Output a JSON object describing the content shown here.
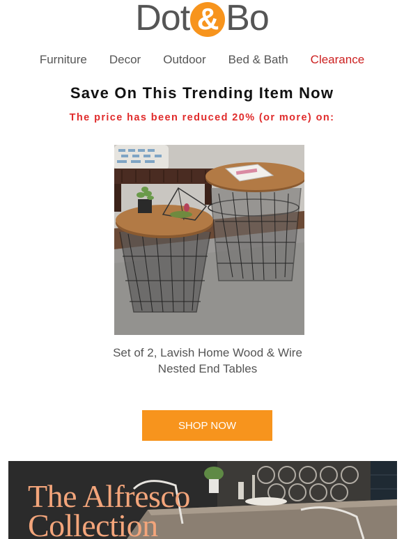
{
  "header": {
    "logo_left": "Dot",
    "logo_amp": "&",
    "logo_right": "Bo"
  },
  "nav": {
    "items": [
      "Furniture",
      "Decor",
      "Outdoor",
      "Bed & Bath"
    ],
    "clearance": "Clearance"
  },
  "promo": {
    "headline": "Save On This Trending Item Now",
    "subline": "The price has been reduced 20% (or more) on:"
  },
  "product": {
    "name": "Set of 2, Lavish Home Wood & Wire Nested End Tables",
    "cta": "SHOP NOW"
  },
  "banner": {
    "title": "The Alfresco\nCollection"
  },
  "colors": {
    "brand_orange": "#f7941d",
    "clearance_red": "#cc1f1f",
    "subline_red": "#e02b2b",
    "banner_title": "#f3a57b"
  }
}
